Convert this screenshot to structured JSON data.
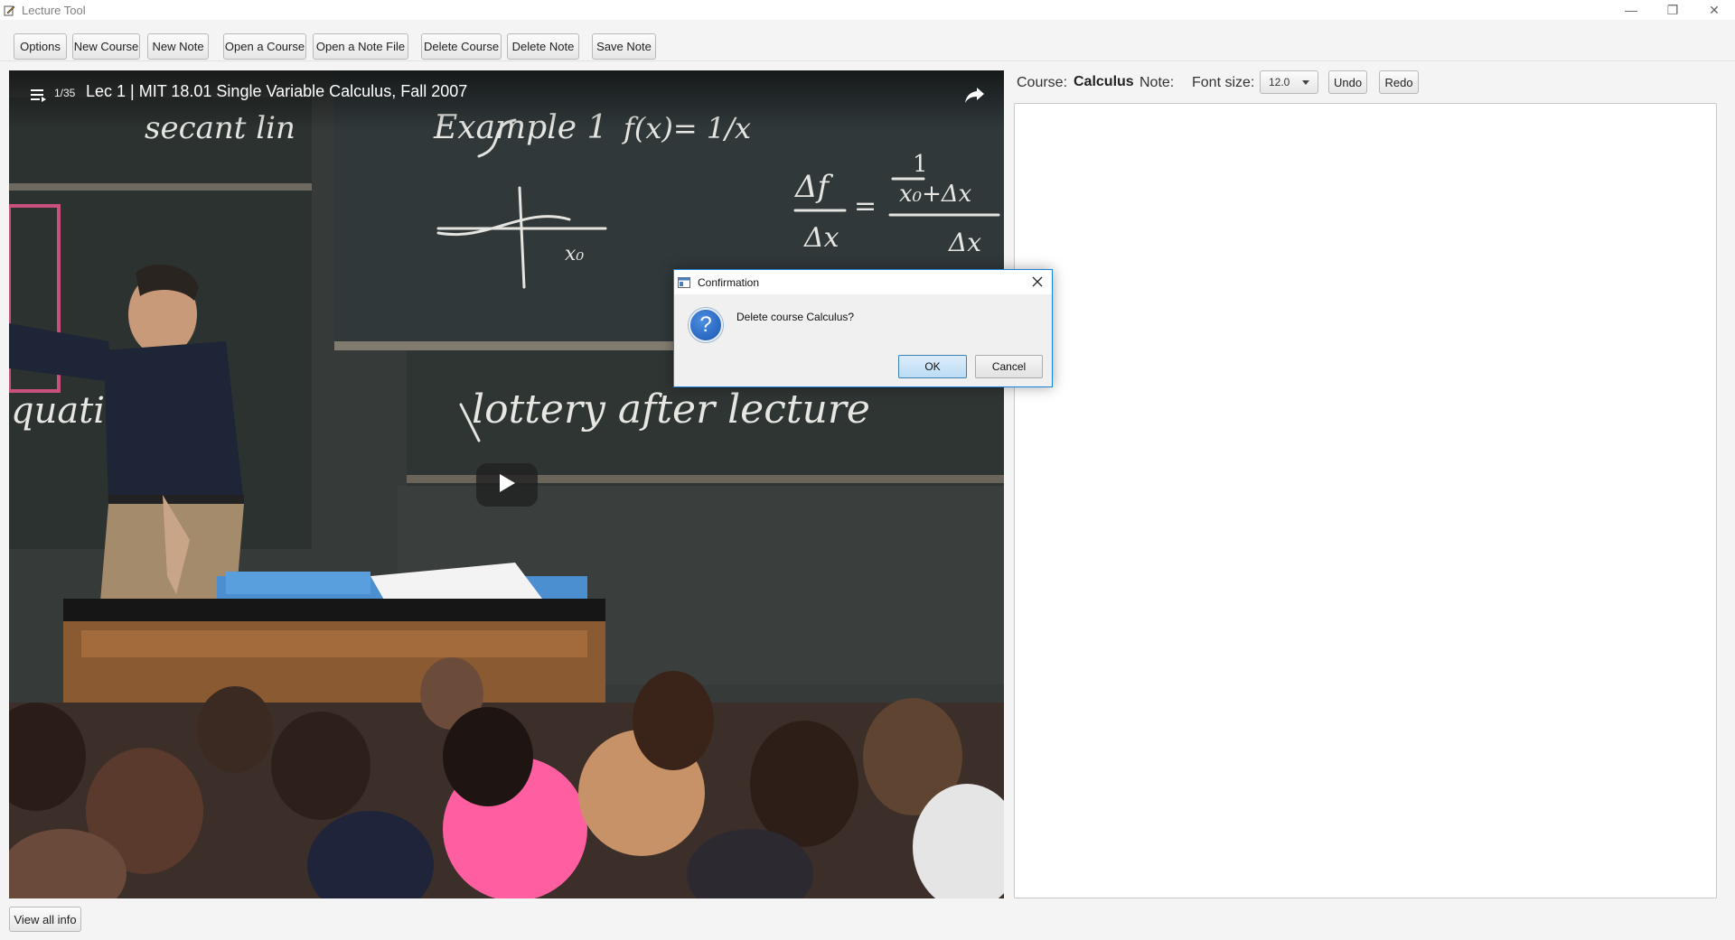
{
  "window": {
    "title": "Lecture Tool",
    "app_icon": "pencil-note-icon",
    "controls": {
      "minimize": "—",
      "restore": "❐",
      "close": "✕"
    }
  },
  "toolbar": {
    "options": "Options",
    "new_course": "New Course",
    "new_note": "New Note",
    "open_course": "Open a Course",
    "open_note_file": "Open a Note File",
    "delete_course": "Delete Course",
    "delete_note": "Delete Note",
    "save_note": "Save Note"
  },
  "video": {
    "playlist_icon": "playlist-icon",
    "playlist_count": "1/35",
    "title": "Lec 1 | MIT 18.01 Single Variable Calculus, Fall 2007",
    "share_icon": "share-icon",
    "play_icon": "play-icon"
  },
  "editor": {
    "course_label": "Course:",
    "course_value": "Calculus",
    "note_label": "Note:",
    "font_size_label": "Font size:",
    "font_size_value": "12.0",
    "undo": "Undo",
    "redo": "Redo"
  },
  "footer": {
    "view_all_info": "View all info"
  },
  "dialog": {
    "title": "Confirmation",
    "icon": "question-icon",
    "question_glyph": "?",
    "message": "Delete course Calculus?",
    "ok": "OK",
    "cancel": "Cancel"
  },
  "colors": {
    "accent": "#1883d7",
    "ok_button": "#bcdcf4",
    "chalkboard": "#2f3331"
  }
}
